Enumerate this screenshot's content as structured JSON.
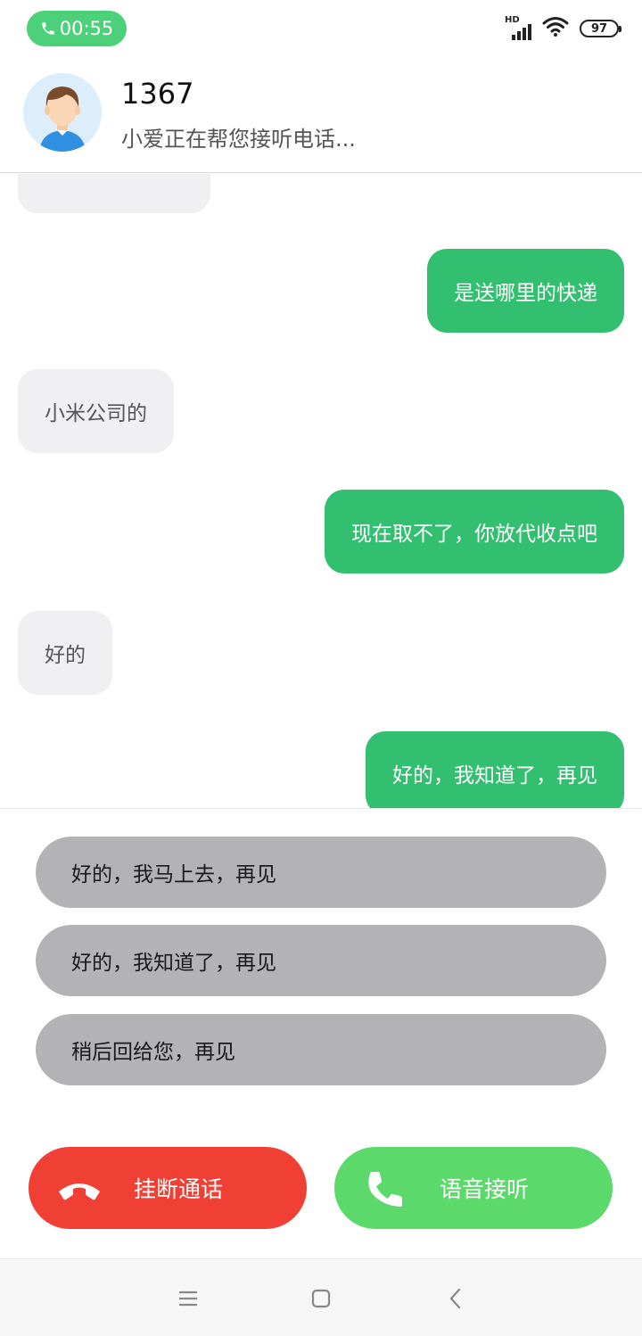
{
  "status_bar": {
    "call_timer": "00:55",
    "network_label": "HD",
    "battery_level": "97"
  },
  "header": {
    "caller_number": "1367",
    "caller_status": "小爱正在帮您接听电话..."
  },
  "messages": [
    {
      "side": "out",
      "text": "是送哪里的快递"
    },
    {
      "side": "in",
      "text": "小米公司的"
    },
    {
      "side": "out",
      "text": "现在取不了，你放代收点吧"
    },
    {
      "side": "in",
      "text": "好的"
    },
    {
      "side": "out",
      "text": "好的，我知道了，再见"
    }
  ],
  "quick_replies": [
    "好的，我马上去，再见",
    "好的，我知道了，再见",
    "稍后回给您，再见"
  ],
  "actions": {
    "hangup_label": "挂断通话",
    "answer_label": "语音接听"
  },
  "colors": {
    "outgoing_bubble": "#33bf70",
    "incoming_bubble": "#f0f0f2",
    "hangup": "#f03f35",
    "answer": "#5bd96a",
    "call_pill": "#4cd07a"
  }
}
